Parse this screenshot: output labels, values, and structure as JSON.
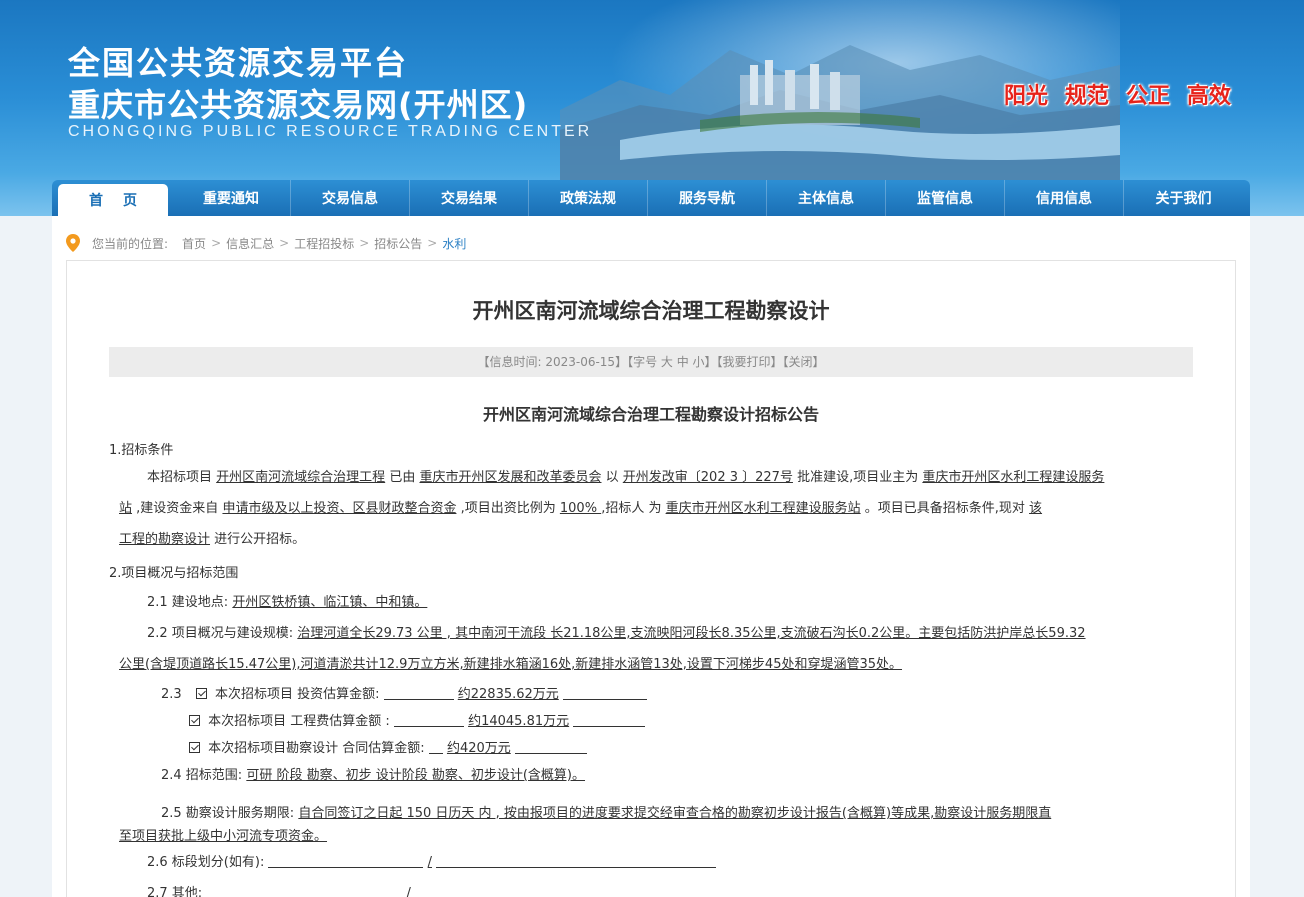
{
  "header": {
    "title_line1": "全国公共资源交易平台",
    "title_line2": "重庆市公共资源交易网(开州区)",
    "subtitle": "CHONGQING PUBLIC RESOURCE TRADING CENTER",
    "slogans": [
      "阳光",
      "规范",
      "公正",
      "高效"
    ],
    "slogan_color": "#e7231b"
  },
  "nav": {
    "items": [
      "首页",
      "重要通知",
      "交易信息",
      "交易结果",
      "政策法规",
      "服务导航",
      "主体信息",
      "监管信息",
      "信用信息",
      "关于我们"
    ]
  },
  "breadcrumb": {
    "prefix": "您当前的位置:",
    "items": [
      "首页",
      "信息汇总",
      "工程招投标",
      "招标公告",
      "水利"
    ],
    "separator": ">"
  },
  "article": {
    "title": "开州区南河流域综合治理工程勘察设计",
    "meta": "【信息时间: 2023-06-15】【字号 大 中 小】【我要打印】【关闭】",
    "subtitle": "开州区南河流域综合治理工程勘察设计招标公告",
    "s1_heading": "1.招标条件",
    "s1": {
      "t1": "本招标项目",
      "u1": "开州区南河流域综合治理工程",
      "t2": "已由",
      "u2": "重庆市开州区发展和改革委员会",
      "t3": "以",
      "u3": "开州发改审〔202 3 〕227号",
      "t4": "批准建设,项目业主为",
      "u4a": "重庆市开州区水利工程建设服务",
      "u4b": "站",
      "t5": ",建设资金来自",
      "u5": "   申请市级及以上投资、区县财政整合资金",
      "t6": ",项目出资比例为",
      "u6": "   100%   ",
      "t7": ",招标人 为",
      "u7": "重庆市开州区水利工程建设服务站",
      "t8": "。项目已具备招标条件,现对",
      "u8a": "该",
      "u8b": "工程的勘察设计",
      "t9": "进行公开招标。"
    },
    "s2_heading": "2.项目概况与招标范围",
    "s21": {
      "label": "2.1 建设地点:",
      "value": "开州区铁桥镇、临江镇、中和镇。"
    },
    "s22": {
      "label": "2.2 项目概况与建设规模:",
      "line1": "   治理河道全长29.73 公里 , 其中南河干流段 长21.18公里,支流映阳河段长8.35公里,支流破石沟长0.2公里。主要包括防洪护岸总长59.32",
      "line2": "公里(含堤顶道路长15.47公里),河道清淤共计12.9万立方米,新建排水箱涵16处,新建排水涵管13处,设置下河梯步45处和穿堤涵管35处。"
    },
    "s23": {
      "num": "2.3",
      "items": [
        {
          "label": "本次招标项目 投资估算金额:",
          "value": "约22835.62万元"
        },
        {
          "label": "本次招标项目 工程费估算金额 :",
          "value": "约14045.81万元"
        },
        {
          "label": "本次招标项目勘察设计 合同估算金额:",
          "value": "约420万元"
        }
      ]
    },
    "s24": {
      "label": "2.4 招标范围:",
      "value": "可研 阶段 勘察、初步 设计阶段 勘察、初步设计(含概算)。"
    },
    "s25": {
      "label": "2.5 勘察设计服务期限:",
      "line1": "   自合同签订之日起   150 日历天 内 , 按由报项目的进度要求提交经审查合格的勘察初步设计报告(含概算)等成果,勘察设计服务期限直",
      "line2": "至项目获批上级中小河流专项资金。"
    },
    "s26": {
      "label": "2.6 标段划分(如有):",
      "slash": "/"
    },
    "s27": {
      "label": "2.7 其他:",
      "slash": "/"
    }
  }
}
